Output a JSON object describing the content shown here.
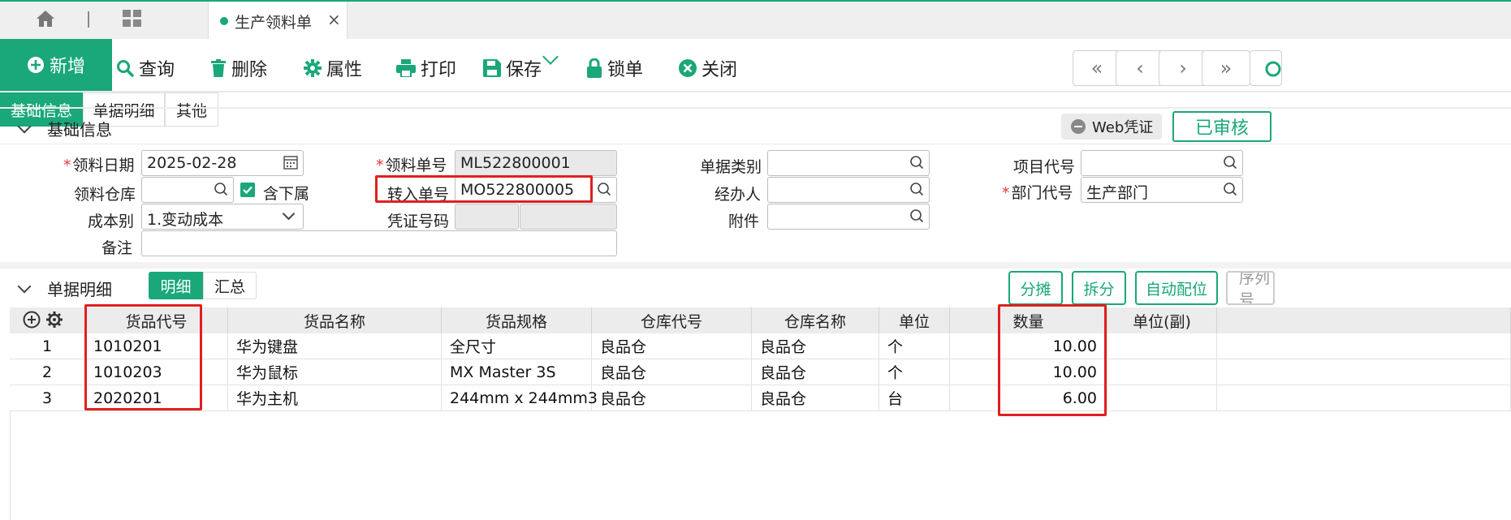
{
  "tabs": {
    "doc_tab": "生产领料单",
    "close": "×"
  },
  "toolbar": {
    "new": "新增",
    "query": "查询",
    "delete": "删除",
    "props": "属性",
    "print": "打印",
    "save": "保存",
    "lock": "锁单",
    "close": "关闭",
    "nav_first": "«",
    "nav_prev": "‹",
    "nav_next": "›",
    "nav_last": "»"
  },
  "section_tabs": [
    "基础信息",
    "单据明细",
    "其他"
  ],
  "basic": {
    "title": "基础信息",
    "web_voucher": "Web凭证",
    "status": "已审核",
    "fields": {
      "date_label": "领料日期",
      "date_value": "2025-02-28",
      "order_no_label": "领料单号",
      "order_no_value": "ML522800001",
      "doc_type_label": "单据类别",
      "doc_type_value": "",
      "project_label": "项目代号",
      "project_value": "",
      "warehouse_label": "领料仓库",
      "warehouse_value": "",
      "include_sub_label": "含下属",
      "transfer_no_label": "转入单号",
      "transfer_no_value": "MO522800005",
      "handler_label": "经办人",
      "handler_value": "",
      "dept_label": "部门代号",
      "dept_value": "生产部门",
      "cost_label": "成本别",
      "cost_value": "1.变动成本",
      "voucher_label": "凭证号码",
      "attach_label": "附件",
      "attach_value": "",
      "remark_label": "备注",
      "remark_value": ""
    }
  },
  "detail": {
    "title": "单据明细",
    "view_tabs": [
      "明细",
      "汇总"
    ],
    "actions": [
      "分摊",
      "拆分",
      "自动配位",
      "序列号"
    ],
    "columns": [
      "货品代号",
      "货品名称",
      "货品规格",
      "仓库代号",
      "仓库名称",
      "单位",
      "数量",
      "单位(副)"
    ],
    "rows": [
      {
        "no": "1",
        "code": "1010201",
        "name": "华为键盘",
        "spec": "全尺寸",
        "wh_code": "良品仓",
        "wh_name": "良品仓",
        "unit": "个",
        "qty": "10.00"
      },
      {
        "no": "2",
        "code": "1010203",
        "name": "华为鼠标",
        "spec": "MX Master 3S",
        "wh_code": "良品仓",
        "wh_name": "良品仓",
        "unit": "个",
        "qty": "10.00"
      },
      {
        "no": "3",
        "code": "2020201",
        "name": "华为主机",
        "spec": "244mm x 244mm3",
        "wh_code": "良品仓",
        "wh_name": "良品仓",
        "unit": "台",
        "qty": "6.00"
      }
    ]
  },
  "colors": {
    "accent": "#1aa779",
    "highlight": "#e0201f"
  }
}
